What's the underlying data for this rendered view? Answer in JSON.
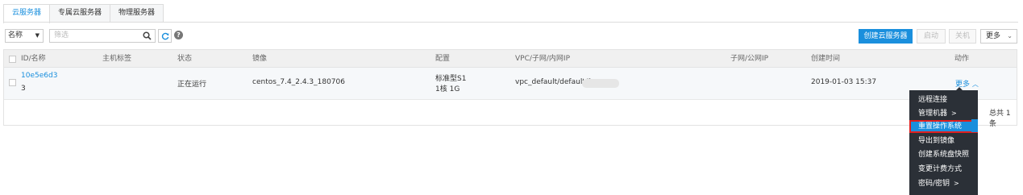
{
  "tabs": [
    "云服务器",
    "专属云服务器",
    "物理服务器"
  ],
  "toolbar": {
    "field_select": "名称",
    "filter_placeholder": "筛选",
    "create_label": "创建云服务器",
    "start_label": "启动",
    "shutdown_label": "关机",
    "more_label": "更多"
  },
  "table": {
    "headers": {
      "id": "ID/名称",
      "tag": "主机标签",
      "status": "状态",
      "image": "镜像",
      "config": "配置",
      "vpc": "VPC/子网/内网IP",
      "subnet": "子网/公网IP",
      "created": "创建时间",
      "actions": "动作"
    },
    "row": {
      "id": "10e5e6d3",
      "name": "3",
      "status": "正在运行",
      "image": "centos_7.4_2.4.3_180706",
      "config_line1": "标准型S1",
      "config_line2": "1核 1G",
      "vpc": "vpc_default/default/1",
      "created": "2019-01-03 15:37",
      "action": "更多"
    },
    "total": "总共 1 条"
  },
  "menu": {
    "items": [
      "远程连接",
      "管理机器",
      "重置操作系统",
      "导出到镜像",
      "创建系统盘快照",
      "变更计费方式",
      "密码/密钥"
    ],
    "highlighted_index": 2
  },
  "colors": {
    "accent": "#1a8fdd",
    "menu_bg": "#2b3037",
    "highlight_border": "#e02020"
  }
}
